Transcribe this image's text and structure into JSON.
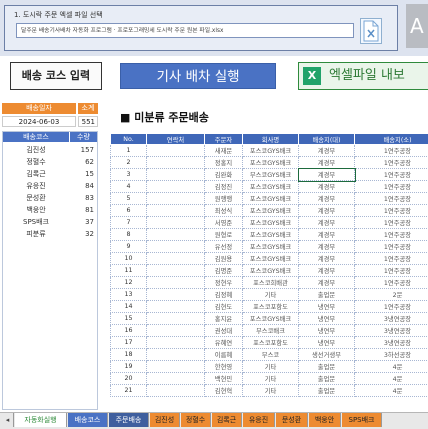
{
  "file_selector": {
    "title": "1. 도시락 주문 엑셀 파일 선택",
    "path": "달주문 배송기사배차 자동화 프로그램 · 프로포그래밍세 도시락 주문 원본 파일.xlsx",
    "right_button": "A"
  },
  "buttons": {
    "route_input": "배송 코스 입력",
    "dispatch": "기사 배차 실행",
    "export": "엑셀파일 내보",
    "excel_icon": "X"
  },
  "left_panel": {
    "header_date_label": "배송일자",
    "header_count_label": "소계",
    "date": "2024-06-03",
    "count": "551",
    "route_header": "배송코스",
    "qty_header": "수량",
    "routes": [
      {
        "name": "김진성",
        "qty": "157"
      },
      {
        "name": "정혈수",
        "qty": "62"
      },
      {
        "name": "김록근",
        "qty": "15"
      },
      {
        "name": "유응진",
        "qty": "84"
      },
      {
        "name": "문성환",
        "qty": "83"
      },
      {
        "name": "백웅안",
        "qty": "81"
      },
      {
        "name": "SPS배크",
        "qty": "37"
      },
      {
        "name": "피분류",
        "qty": "32"
      }
    ]
  },
  "main": {
    "title": "■ 미분류 주문배송",
    "columns": [
      "No.",
      "연락처",
      "주문자",
      "회사명",
      "배송지(대)",
      "배송지(소)"
    ],
    "rows": [
      [
        "1",
        "",
        "새재문",
        "포스코GYS배크",
        "계경부",
        "1연주공장"
      ],
      [
        "2",
        "",
        "정홍지",
        "포스코GYS배크",
        "계경부",
        "1연주공장"
      ],
      [
        "3",
        "",
        "김완화",
        "부스코GYS배크",
        "계경부",
        "1연주공장"
      ],
      [
        "4",
        "",
        "김정진",
        "포스코GYS배크",
        "계경부",
        "1연주공장"
      ],
      [
        "5",
        "",
        "원행행",
        "포스코GYS배크",
        "계경부",
        "1연주공장"
      ],
      [
        "6",
        "",
        "최성식",
        "포스코GYS배크",
        "계경부",
        "1연주공장"
      ],
      [
        "7",
        "",
        "서영준",
        "포스코GYS배크",
        "계경부",
        "1연주공장"
      ],
      [
        "8",
        "",
        "원형로",
        "포스코GYS배크",
        "계경부",
        "1연주공장"
      ],
      [
        "9",
        "",
        "유선정",
        "포스코GYS배크",
        "계경부",
        "1연주공장"
      ],
      [
        "10",
        "",
        "김원용",
        "포스코GYS배크",
        "계경부",
        "1연주공장"
      ],
      [
        "11",
        "",
        "김명준",
        "포스코GYS배크",
        "계경부",
        "1연주공장"
      ],
      [
        "12",
        "",
        "정현우",
        "포스코희배관",
        "계경부",
        "1연주공장"
      ],
      [
        "13",
        "",
        "김정혜",
        "기타",
        "출업문",
        "2문"
      ],
      [
        "14",
        "",
        "김현도",
        "포스코포항도",
        "냉연부",
        "1연주공장"
      ],
      [
        "15",
        "",
        "홍지윤",
        "포스코GYS배크",
        "냉연부",
        "3냉연공장"
      ],
      [
        "16",
        "",
        "권성대",
        "부스코배크",
        "냉연부",
        "3냉연공장"
      ],
      [
        "17",
        "",
        "유혜연",
        "포스코포항도",
        "냉연부",
        "3냉연공장"
      ],
      [
        "18",
        "",
        "이름혜",
        "부스코",
        "생선거생부",
        "3하선공장"
      ],
      [
        "19",
        "",
        "한현영",
        "기타",
        "출업문",
        "4문"
      ],
      [
        "20",
        "",
        "백현민",
        "기타",
        "출업문",
        "4문"
      ],
      [
        "21",
        "",
        "김현혁",
        "기타",
        "출업문",
        "4문"
      ]
    ]
  },
  "sheet_tabs": [
    "◂",
    "자동화실행",
    "배송코스",
    "주문배송",
    "김진성",
    "정혈수",
    "김록근",
    "유응진",
    "문성환",
    "백웅안",
    "SPS배크"
  ]
}
